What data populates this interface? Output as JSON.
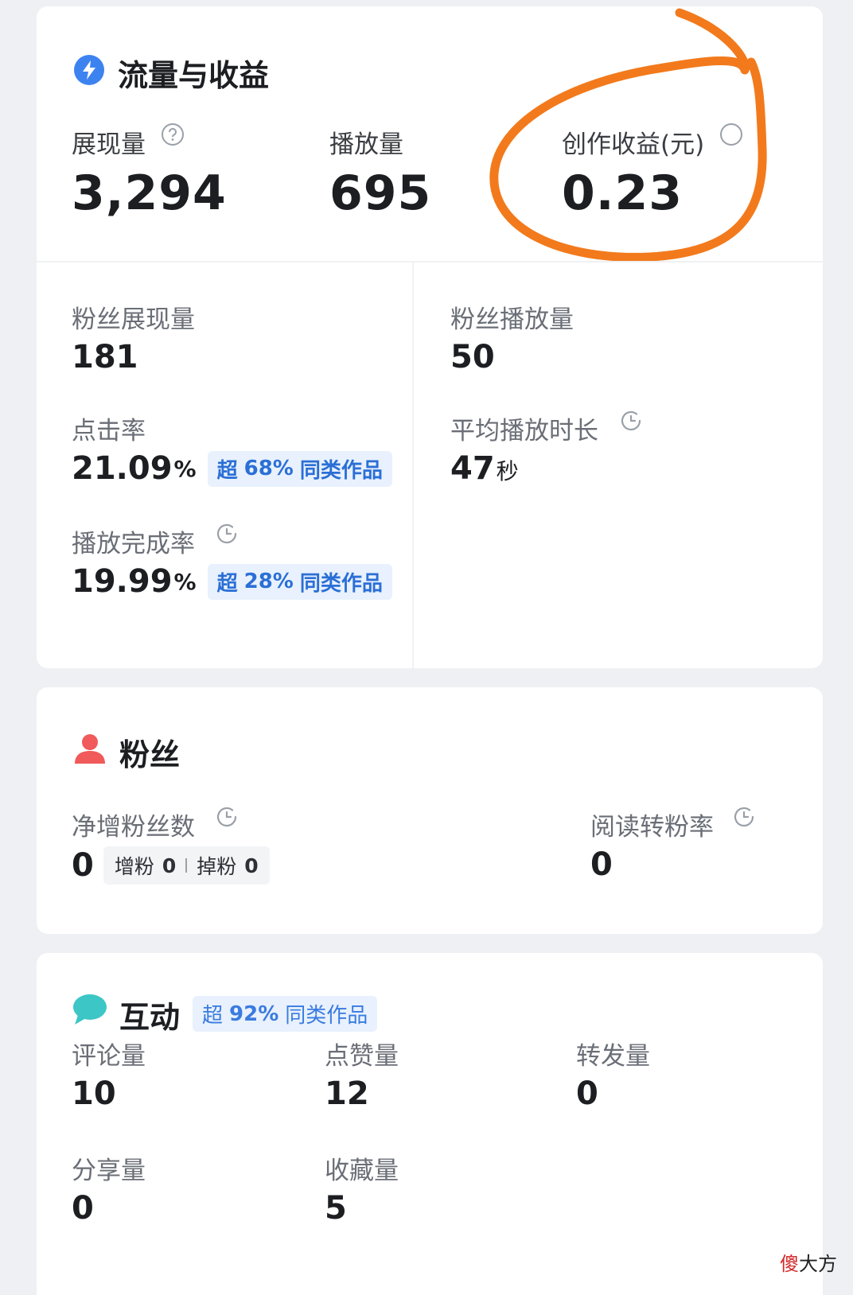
{
  "traffic": {
    "title": "流量与收益",
    "impressions": {
      "label": "展现量",
      "value": "3,294",
      "info_icon": "question-circle-icon"
    },
    "plays": {
      "label": "播放量",
      "value": "695"
    },
    "earnings": {
      "label": "创作收益(元)",
      "value": "0.23"
    },
    "fan_impressions": {
      "label": "粉丝展现量",
      "value": "181"
    },
    "fan_plays": {
      "label": "粉丝播放量",
      "value": "50"
    },
    "ctr": {
      "label": "点击率",
      "value": "21.09",
      "unit": "%",
      "badge_prefix": "超",
      "badge_pct": "68%",
      "badge_suffix": "同类作品"
    },
    "avg_duration": {
      "label": "平均播放时长",
      "value": "47",
      "unit": "秒"
    },
    "completion": {
      "label": "播放完成率",
      "value": "19.99",
      "unit": "%",
      "badge_prefix": "超",
      "badge_pct": "28%",
      "badge_suffix": "同类作品"
    }
  },
  "fans": {
    "title": "粉丝",
    "net_gain": {
      "label": "净增粉丝数",
      "value": "0",
      "gain_label": "增粉",
      "gain_value": "0",
      "loss_label": "掉粉",
      "loss_value": "0"
    },
    "read_to_fan": {
      "label": "阅读转粉率",
      "value": "0"
    }
  },
  "interact": {
    "title": "互动",
    "badge_prefix": "超",
    "badge_pct": "92%",
    "badge_suffix": "同类作品",
    "comments": {
      "label": "评论量",
      "value": "10"
    },
    "likes": {
      "label": "点赞量",
      "value": "12"
    },
    "forwards": {
      "label": "转发量",
      "value": "0"
    },
    "shares": {
      "label": "分享量",
      "value": "0"
    },
    "favorites": {
      "label": "收藏量",
      "value": "5"
    }
  },
  "watermark": {
    "part1": "傻",
    "part2": "大方"
  },
  "colors": {
    "accent_blue": "#2b6fd6",
    "annotation_orange": "#f27a1c",
    "fans_red": "#f05a5a",
    "chat_teal": "#3cc6c6"
  }
}
